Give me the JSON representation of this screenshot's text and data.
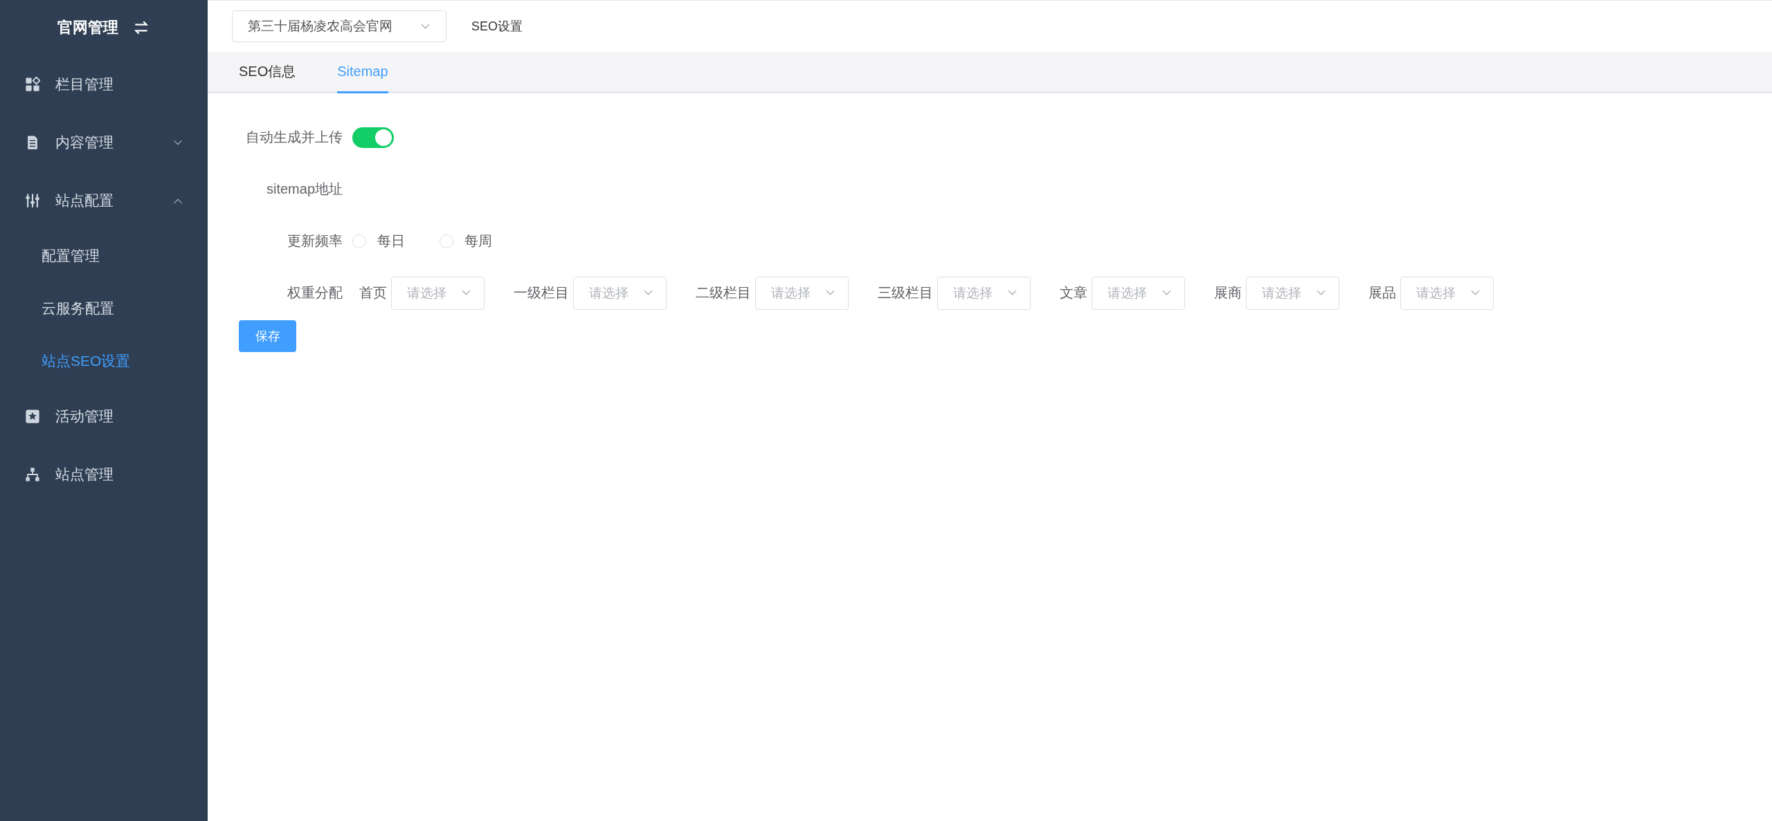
{
  "sidebar": {
    "title": "官网管理",
    "items": [
      {
        "label": "栏目管理",
        "selected": false
      },
      {
        "label": "内容管理",
        "selected": false,
        "expanded": false
      },
      {
        "label": "站点配置",
        "selected": false,
        "expanded": true,
        "children": [
          {
            "label": "配置管理",
            "selected": false
          },
          {
            "label": "云服务配置",
            "selected": false
          },
          {
            "label": "站点SEO设置",
            "selected": true
          }
        ]
      },
      {
        "label": "活动管理",
        "selected": false
      },
      {
        "label": "站点管理",
        "selected": false
      }
    ]
  },
  "header": {
    "site_select": {
      "value": "第三十届杨凌农高会官网"
    },
    "breadcrumb": "SEO设置"
  },
  "tabs": [
    {
      "label": "SEO信息",
      "selected": false
    },
    {
      "label": "Sitemap",
      "selected": true
    }
  ],
  "form": {
    "auto_generate": {
      "label": "自动生成并上传",
      "on": true
    },
    "sitemap_url": {
      "label": "sitemap地址"
    },
    "frequency": {
      "label": "更新频率",
      "options": [
        {
          "label": "每日",
          "selected": false
        },
        {
          "label": "每周",
          "selected": false
        }
      ]
    },
    "weights": {
      "label": "权重分配",
      "fields": [
        {
          "label": "首页",
          "placeholder": "请选择"
        },
        {
          "label": "一级栏目",
          "placeholder": "请选择"
        },
        {
          "label": "二级栏目",
          "placeholder": "请选择"
        },
        {
          "label": "三级栏目",
          "placeholder": "请选择"
        },
        {
          "label": "文章",
          "placeholder": "请选择"
        },
        {
          "label": "展商",
          "placeholder": "请选择"
        },
        {
          "label": "展品",
          "placeholder": "请选择"
        }
      ]
    },
    "save_button": "保存"
  }
}
